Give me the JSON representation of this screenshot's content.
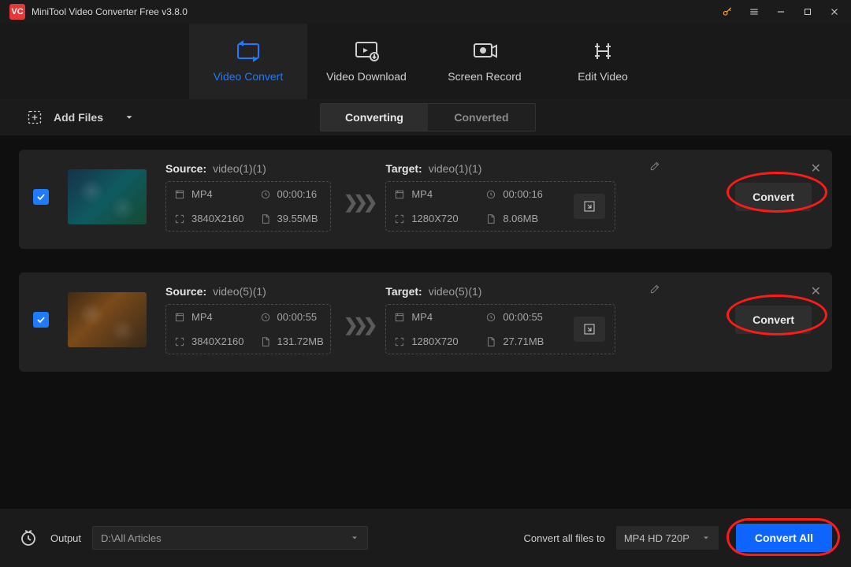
{
  "app": {
    "title": "MiniTool Video Converter Free v3.8.0"
  },
  "nav": {
    "items": [
      {
        "label": "Video Convert"
      },
      {
        "label": "Video Download"
      },
      {
        "label": "Screen Record"
      },
      {
        "label": "Edit Video"
      }
    ]
  },
  "toolbar": {
    "add_files": "Add Files",
    "status_tabs": {
      "converting": "Converting",
      "converted": "Converted"
    }
  },
  "labels": {
    "source": "Source:",
    "target": "Target:",
    "convert": "Convert",
    "arrows": "❯❯❯"
  },
  "items": [
    {
      "checked": true,
      "source": {
        "filename": "video(1)(1)",
        "format": "MP4",
        "duration": "00:00:16",
        "resolution": "3840X2160",
        "size": "39.55MB"
      },
      "target": {
        "filename": "video(1)(1)",
        "format": "MP4",
        "duration": "00:00:16",
        "resolution": "1280X720",
        "size": "8.06MB"
      }
    },
    {
      "checked": true,
      "source": {
        "filename": "video(5)(1)",
        "format": "MP4",
        "duration": "00:00:55",
        "resolution": "3840X2160",
        "size": "131.72MB"
      },
      "target": {
        "filename": "video(5)(1)",
        "format": "MP4",
        "duration": "00:00:55",
        "resolution": "1280X720",
        "size": "27.71MB"
      }
    }
  ],
  "bottom": {
    "output_label": "Output",
    "output_path": "D:\\All Articles",
    "convert_all_label": "Convert all files to",
    "preset": "MP4 HD 720P",
    "convert_all_btn": "Convert All"
  }
}
